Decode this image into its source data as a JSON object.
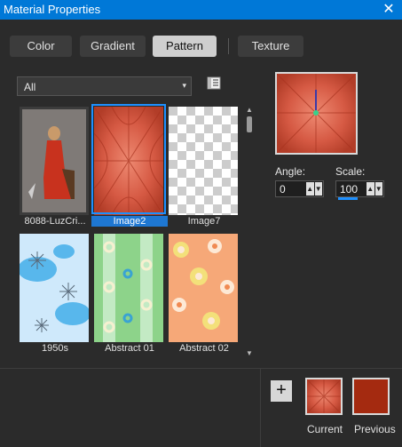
{
  "window": {
    "title": "Material Properties",
    "close_glyph": "✕"
  },
  "tabs": [
    {
      "label": "Color"
    },
    {
      "label": "Gradient"
    },
    {
      "label": "Pattern"
    },
    {
      "label": "Texture"
    }
  ],
  "category": {
    "value": "All"
  },
  "patterns": [
    {
      "label": "8088-LuzCri..."
    },
    {
      "label": "Image2"
    },
    {
      "label": "Image7"
    },
    {
      "label": "1950s"
    },
    {
      "label": "Abstract 01"
    },
    {
      "label": "Abstract 02"
    }
  ],
  "settings": {
    "angle_label": "Angle:",
    "angle_value": "0",
    "scale_label": "Scale:",
    "scale_value": "100"
  },
  "swatches": {
    "current_label": "Current",
    "previous_label": "Previous",
    "previous_color": "#a42a10"
  },
  "icons": {
    "add": "+",
    "dropdown_arrow": "▾",
    "spin_up": "▲",
    "spin_down": "▼",
    "scroll_up": "▲",
    "scroll_down": "▼"
  },
  "colors": {
    "title_bar": "#0078d7",
    "accent": "#1e90ff",
    "pattern_red": "#d65a44"
  }
}
